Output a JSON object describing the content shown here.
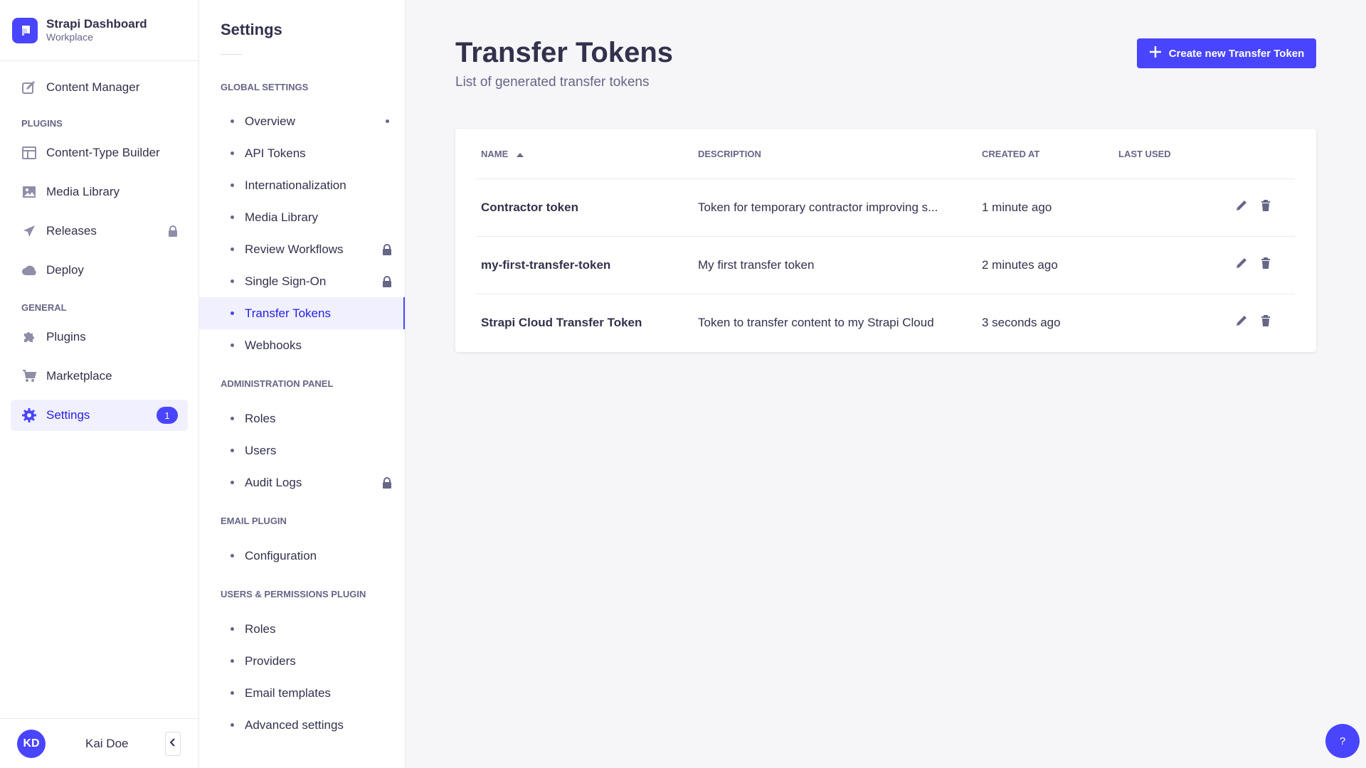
{
  "brand": {
    "title": "Strapi Dashboard",
    "subtitle": "Workplace"
  },
  "mainnav": {
    "content_manager": "Content Manager",
    "plugins_label": "PLUGINS",
    "plugins": [
      "Content-Type Builder",
      "Media Library",
      "Releases",
      "Deploy"
    ],
    "general_label": "GENERAL",
    "general": [
      "Plugins",
      "Marketplace",
      "Settings"
    ],
    "settings_badge": "1"
  },
  "user": {
    "initials": "KD",
    "name": "Kai Doe"
  },
  "subnav": {
    "title": "Settings",
    "global_label": "GLOBAL SETTINGS",
    "global": [
      "Overview",
      "API Tokens",
      "Internationalization",
      "Media Library",
      "Review Workflows",
      "Single Sign-On",
      "Transfer Tokens",
      "Webhooks"
    ],
    "admin_label": "ADMINISTRATION PANEL",
    "admin": [
      "Roles",
      "Users",
      "Audit Logs"
    ],
    "email_label": "EMAIL PLUGIN",
    "email": [
      "Configuration"
    ],
    "users_label": "USERS & PERMISSIONS PLUGIN",
    "users": [
      "Roles",
      "Providers",
      "Email templates",
      "Advanced settings"
    ]
  },
  "page": {
    "title": "Transfer Tokens",
    "subtitle": "List of generated transfer tokens",
    "create_label": "Create new Transfer Token"
  },
  "table": {
    "headers": {
      "name": "NAME",
      "description": "DESCRIPTION",
      "created_at": "CREATED AT",
      "last_used": "LAST USED"
    },
    "rows": [
      {
        "name": "Contractor token",
        "description": "Token for temporary contractor improving s...",
        "created_at": "1 minute ago",
        "last_used": ""
      },
      {
        "name": "my-first-transfer-token",
        "description": "My first transfer token",
        "created_at": "2 minutes ago",
        "last_used": ""
      },
      {
        "name": "Strapi Cloud Transfer Token",
        "description": "Token to transfer content to my Strapi Cloud",
        "created_at": "3 seconds ago",
        "last_used": ""
      }
    ]
  },
  "help": "?",
  "colors": {
    "accent": "#4945ff",
    "active_text": "#271fe0",
    "active_bg": "#f0f0ff"
  }
}
